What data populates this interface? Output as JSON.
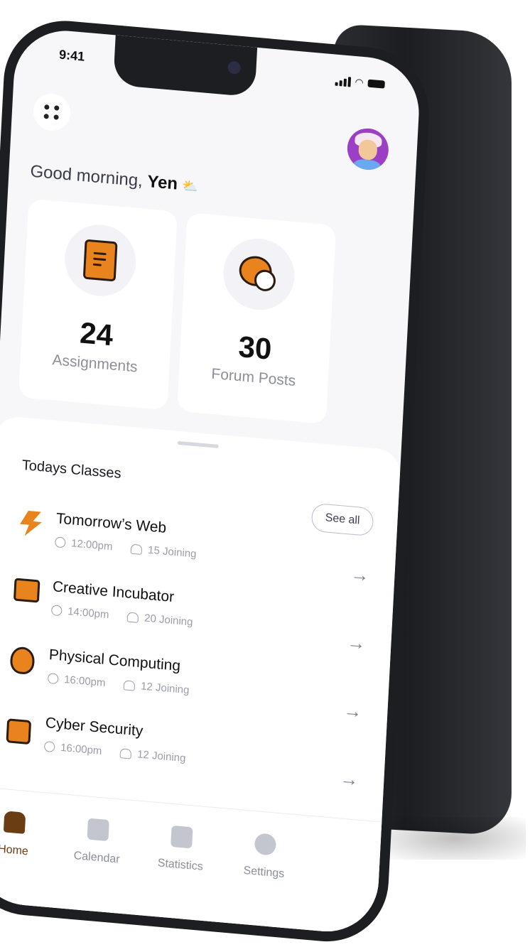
{
  "status_bar": {
    "time": "9:41"
  },
  "header": {
    "menu_icon": "grid-dots-icon",
    "avatar_icon": "user-avatar",
    "greeting_prefix": "Good morning,",
    "greeting_name": "Yen",
    "greeting_emoji": "⛅"
  },
  "stats": [
    {
      "value": "24",
      "label": "Assignments",
      "icon": "document-icon"
    },
    {
      "value": "30",
      "label": "Forum Posts",
      "icon": "chat-bubbles-icon"
    }
  ],
  "classes_section": {
    "title": "Todays Classes",
    "see_all_label": "See all",
    "items": [
      {
        "name": "Tomorrow’s Web",
        "time": "12:00pm",
        "joining": "15 Joining",
        "icon": "lightning-icon"
      },
      {
        "name": "Creative Incubator",
        "time": "14:00pm",
        "joining": "20 Joining",
        "icon": "monitor-icon"
      },
      {
        "name": "Physical Computing",
        "time": "16:00pm",
        "joining": "12 Joining",
        "icon": "bug-icon"
      },
      {
        "name": "Cyber Security",
        "time": "16:00pm",
        "joining": "12 Joining",
        "icon": "robot-icon"
      }
    ]
  },
  "tabbar": {
    "tabs": [
      {
        "label": "Home",
        "icon": "home-icon",
        "active": true
      },
      {
        "label": "Calendar",
        "icon": "calendar-icon",
        "active": false
      },
      {
        "label": "Statistics",
        "icon": "bar-chart-icon",
        "active": false
      },
      {
        "label": "Settings",
        "icon": "gear-icon",
        "active": false
      }
    ]
  },
  "colors": {
    "accent": "#E8831E",
    "active_tab": "#6B3D12",
    "background": "#F7F7F9"
  }
}
